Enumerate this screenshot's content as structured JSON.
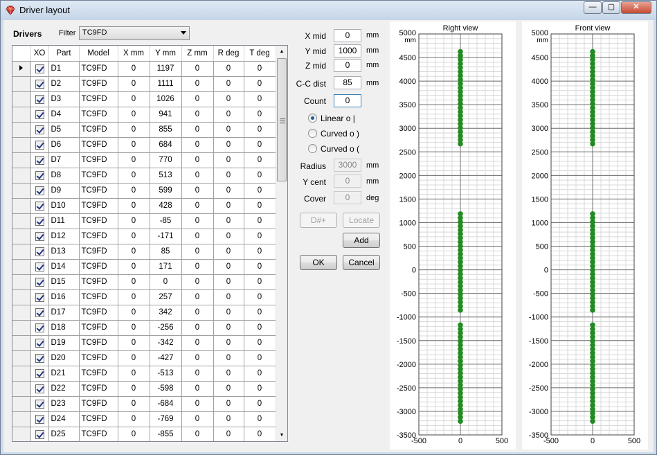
{
  "window": {
    "title": "Driver layout",
    "min": "—",
    "max": "▢",
    "close": "✕"
  },
  "left": {
    "drivers_label": "Drivers",
    "filter_label": "Filter",
    "filter_value": "TC9FD",
    "columns": [
      "XO",
      "Part",
      "Model",
      "X mm",
      "Y mm",
      "Z mm",
      "R deg",
      "T deg"
    ],
    "rows": [
      [
        "D1",
        "TC9FD",
        "0",
        "1197",
        "0",
        "0",
        "0"
      ],
      [
        "D2",
        "TC9FD",
        "0",
        "1111",
        "0",
        "0",
        "0"
      ],
      [
        "D3",
        "TC9FD",
        "0",
        "1026",
        "0",
        "0",
        "0"
      ],
      [
        "D4",
        "TC9FD",
        "0",
        "941",
        "0",
        "0",
        "0"
      ],
      [
        "D5",
        "TC9FD",
        "0",
        "855",
        "0",
        "0",
        "0"
      ],
      [
        "D6",
        "TC9FD",
        "0",
        "684",
        "0",
        "0",
        "0"
      ],
      [
        "D7",
        "TC9FD",
        "0",
        "770",
        "0",
        "0",
        "0"
      ],
      [
        "D8",
        "TC9FD",
        "0",
        "513",
        "0",
        "0",
        "0"
      ],
      [
        "D9",
        "TC9FD",
        "0",
        "599",
        "0",
        "0",
        "0"
      ],
      [
        "D10",
        "TC9FD",
        "0",
        "428",
        "0",
        "0",
        "0"
      ],
      [
        "D11",
        "TC9FD",
        "0",
        "-85",
        "0",
        "0",
        "0"
      ],
      [
        "D12",
        "TC9FD",
        "0",
        "-171",
        "0",
        "0",
        "0"
      ],
      [
        "D13",
        "TC9FD",
        "0",
        "85",
        "0",
        "0",
        "0"
      ],
      [
        "D14",
        "TC9FD",
        "0",
        "171",
        "0",
        "0",
        "0"
      ],
      [
        "D15",
        "TC9FD",
        "0",
        "0",
        "0",
        "0",
        "0"
      ],
      [
        "D16",
        "TC9FD",
        "0",
        "257",
        "0",
        "0",
        "0"
      ],
      [
        "D17",
        "TC9FD",
        "0",
        "342",
        "0",
        "0",
        "0"
      ],
      [
        "D18",
        "TC9FD",
        "0",
        "-256",
        "0",
        "0",
        "0"
      ],
      [
        "D19",
        "TC9FD",
        "0",
        "-342",
        "0",
        "0",
        "0"
      ],
      [
        "D20",
        "TC9FD",
        "0",
        "-427",
        "0",
        "0",
        "0"
      ],
      [
        "D21",
        "TC9FD",
        "0",
        "-513",
        "0",
        "0",
        "0"
      ],
      [
        "D22",
        "TC9FD",
        "0",
        "-598",
        "0",
        "0",
        "0"
      ],
      [
        "D23",
        "TC9FD",
        "0",
        "-684",
        "0",
        "0",
        "0"
      ],
      [
        "D24",
        "TC9FD",
        "0",
        "-769",
        "0",
        "0",
        "0"
      ],
      [
        "D25",
        "TC9FD",
        "0",
        "-855",
        "0",
        "0",
        "0"
      ]
    ]
  },
  "form": {
    "xmid_label": "X mid",
    "xmid": "0",
    "ymid_label": "Y mid",
    "ymid": "1000",
    "zmid_label": "Z mid",
    "zmid": "0",
    "ccdist_label": "C-C dist",
    "ccdist": "85",
    "count_label": "Count",
    "count": "0",
    "unit_mm": "mm",
    "unit_deg": "deg",
    "linear": "Linear  o  |",
    "curved1": "Curved  o  )",
    "curved2": "Curved  o  (",
    "radius_label": "Radius",
    "radius": "3000",
    "ycent_label": "Y cent",
    "ycent": "0",
    "cover_label": "Cover",
    "cover": "0",
    "dplus": "D#+",
    "locate": "Locate",
    "add": "Add",
    "ok": "OK",
    "cancel": "Cancel"
  },
  "colors": {
    "dot": "#228b22",
    "grid_major": "#707070",
    "grid_minor": "#d8d8d8"
  },
  "chart_data": [
    {
      "type": "scatter",
      "title": "Right view",
      "ylabel": "mm",
      "xlim": [
        -500,
        500
      ],
      "ylim": [
        -3500,
        5000
      ],
      "x_ticks": [
        "-500",
        "0",
        "500"
      ],
      "y_ticks": [
        "5000",
        "4500",
        "4000",
        "3500",
        "3000",
        "2500",
        "2000",
        "1500",
        "1000",
        "500",
        "0",
        "-500",
        "-1000",
        "-1500",
        "-2000",
        "-2500",
        "-3000",
        "-3500"
      ],
      "series": [
        {
          "x": 0,
          "y_from": 2670,
          "y_to": 4690,
          "step": 85
        },
        {
          "x": 0,
          "y_from": -855,
          "y_to": 1197,
          "step": 85
        },
        {
          "x": 0,
          "y_from": -3210,
          "y_to": -1170,
          "step": 85
        }
      ]
    },
    {
      "type": "scatter",
      "title": "Front view",
      "ylabel": "mm",
      "xlim": [
        -500,
        500
      ],
      "ylim": [
        -3500,
        5000
      ],
      "x_ticks": [
        "-500",
        "0",
        "500"
      ],
      "y_ticks": [
        "5000",
        "4500",
        "4000",
        "3500",
        "3000",
        "2500",
        "2000",
        "1500",
        "1000",
        "500",
        "0",
        "-500",
        "-1000",
        "-1500",
        "-2000",
        "-2500",
        "-3000",
        "-3500"
      ],
      "series": [
        {
          "x": 0,
          "y_from": 2670,
          "y_to": 4690,
          "step": 85
        },
        {
          "x": 0,
          "y_from": -855,
          "y_to": 1197,
          "step": 85
        },
        {
          "x": 0,
          "y_from": -3210,
          "y_to": -1170,
          "step": 85
        }
      ]
    }
  ]
}
